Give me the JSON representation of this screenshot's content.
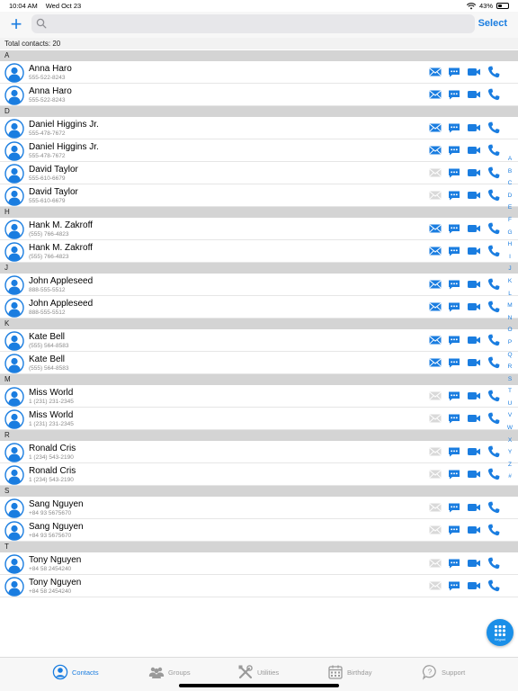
{
  "status_bar": {
    "time": "10:04 AM",
    "date": "Wed Oct 23",
    "battery": "43%",
    "battery_level": 0.43
  },
  "top_bar": {
    "add_label": "+",
    "search_placeholder": "",
    "select_label": "Select"
  },
  "total_label": "Total contacts: 20",
  "colors": {
    "accent": "#1a7de0",
    "avatar": "#1a7de0",
    "disabled": "#d9d9d9",
    "section": "#d4d4d4"
  },
  "sections": [
    {
      "letter": "A",
      "contacts": [
        {
          "name": "Anna Haro",
          "phone": "555-522-8243",
          "email": true
        },
        {
          "name": "Anna Haro",
          "phone": "555-522-8243",
          "email": true
        }
      ]
    },
    {
      "letter": "D",
      "contacts": [
        {
          "name": "Daniel Higgins Jr.",
          "phone": "555-478-7672",
          "email": true
        },
        {
          "name": "Daniel Higgins Jr.",
          "phone": "555-478-7672",
          "email": true
        },
        {
          "name": "David Taylor",
          "phone": "555-610-6679",
          "email": false
        },
        {
          "name": "David Taylor",
          "phone": "555-610-6679",
          "email": false
        }
      ]
    },
    {
      "letter": "H",
      "contacts": [
        {
          "name": "Hank M. Zakroff",
          "phone": "(555) 766-4823",
          "email": true
        },
        {
          "name": "Hank M. Zakroff",
          "phone": "(555) 766-4823",
          "email": true
        }
      ]
    },
    {
      "letter": "J",
      "contacts": [
        {
          "name": "John Appleseed",
          "phone": "888-555-5512",
          "email": true
        },
        {
          "name": "John Appleseed",
          "phone": "888-555-5512",
          "email": true
        }
      ]
    },
    {
      "letter": "K",
      "contacts": [
        {
          "name": "Kate Bell",
          "phone": "(555) 564-8583",
          "email": true
        },
        {
          "name": "Kate Bell",
          "phone": "(555) 564-8583",
          "email": true
        }
      ]
    },
    {
      "letter": "M",
      "contacts": [
        {
          "name": "Miss World",
          "phone": "1 (231) 231-2345",
          "email": false
        },
        {
          "name": "Miss World",
          "phone": "1 (231) 231-2345",
          "email": false
        }
      ]
    },
    {
      "letter": "R",
      "contacts": [
        {
          "name": "Ronald Cris",
          "phone": "1 (234) 543-2190",
          "email": false
        },
        {
          "name": "Ronald Cris",
          "phone": "1 (234) 543-2190",
          "email": false
        }
      ]
    },
    {
      "letter": "S",
      "contacts": [
        {
          "name": "Sang Nguyen",
          "phone": "+84 93 5675670",
          "email": false
        },
        {
          "name": "Sang Nguyen",
          "phone": "+84 93 5675670",
          "email": false
        }
      ]
    },
    {
      "letter": "T",
      "contacts": [
        {
          "name": "Tony Nguyen",
          "phone": "+84 58 2454240",
          "email": false
        },
        {
          "name": "Tony Nguyen",
          "phone": "+84 58 2454240",
          "email": false
        }
      ]
    }
  ],
  "alphabet": [
    "A",
    "B",
    "C",
    "D",
    "E",
    "F",
    "G",
    "H",
    "I",
    "J",
    "K",
    "L",
    "M",
    "N",
    "O",
    "P",
    "Q",
    "R",
    "S",
    "T",
    "U",
    "V",
    "W",
    "X",
    "Y",
    "Z",
    "#"
  ],
  "fab": {
    "icon": "keypad-icon",
    "label": "Keypad"
  },
  "tabs": [
    {
      "label": "Contacts",
      "icon": "person-icon",
      "active": true
    },
    {
      "label": "Groups",
      "icon": "groups-icon",
      "active": false
    },
    {
      "label": "Utilities",
      "icon": "tools-icon",
      "active": false
    },
    {
      "label": "Birthday",
      "icon": "calendar-icon",
      "active": false
    },
    {
      "label": "Support",
      "icon": "help-icon",
      "active": false
    }
  ]
}
